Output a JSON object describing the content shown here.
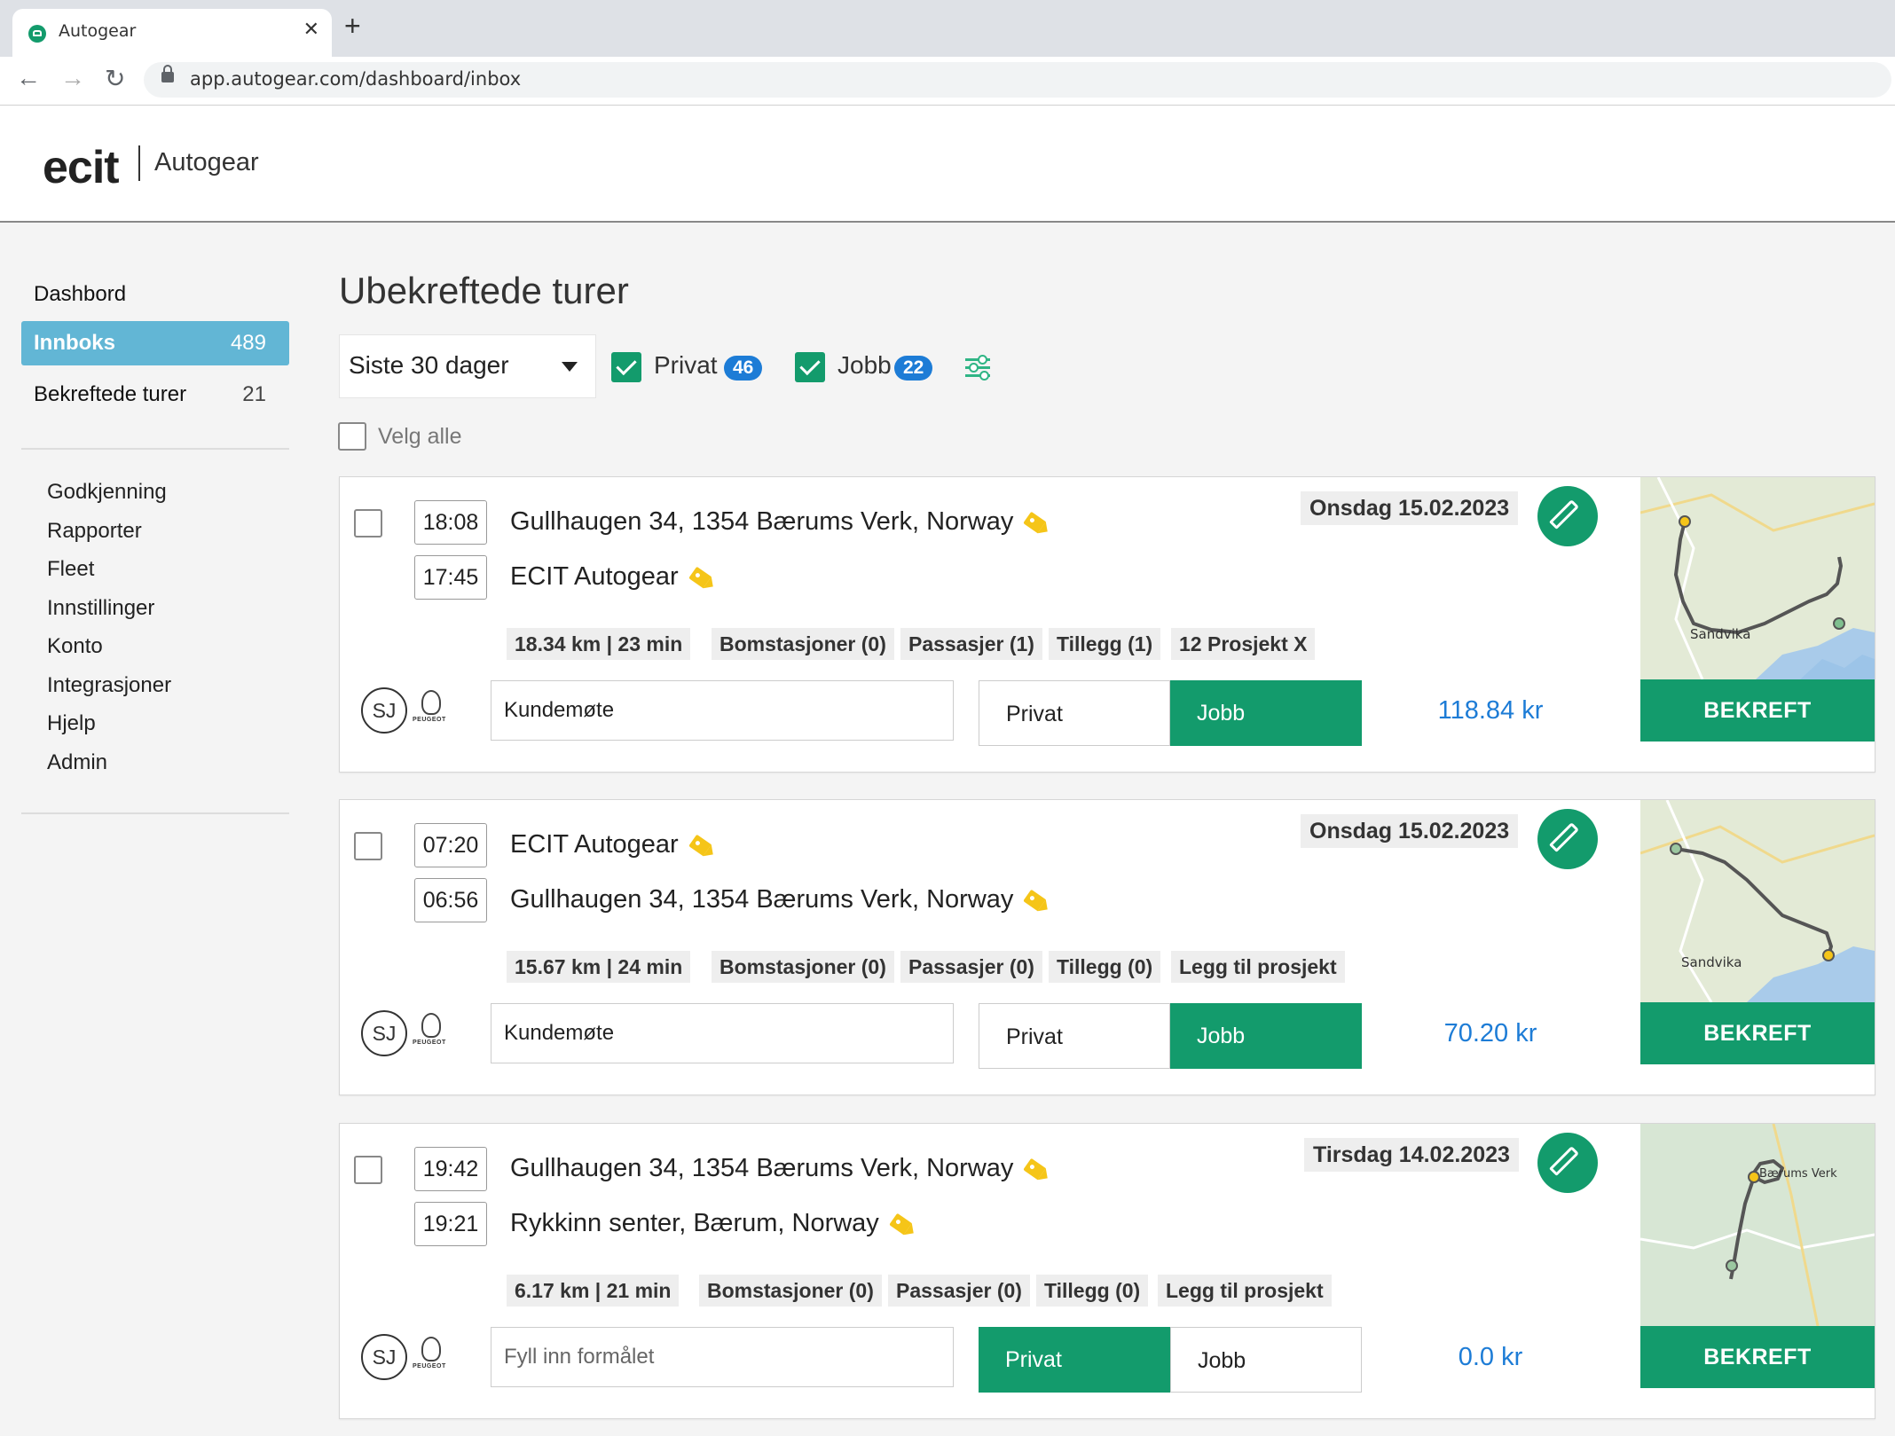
{
  "browser": {
    "tab_title": "Autogear",
    "tab_close": "✕",
    "new_tab": "+",
    "url": "app.autogear.com/dashboard/inbox"
  },
  "header": {
    "logo": "ecit",
    "product": "Autogear"
  },
  "sidebar": {
    "primary": [
      {
        "label": "Dashbord",
        "count": ""
      },
      {
        "label": "Innboks",
        "count": "489"
      },
      {
        "label": "Bekreftede turer",
        "count": "21"
      }
    ],
    "links": [
      "Godkjenning",
      "Rapporter",
      "Fleet",
      "Innstillinger",
      "Konto",
      "Integrasjoner",
      "Hjelp",
      "Admin"
    ]
  },
  "main": {
    "title": "Ubekreftede turer",
    "period": "Siste 30 dager",
    "filters": [
      {
        "label": "Privat",
        "count": "46"
      },
      {
        "label": "Jobb",
        "count": "22"
      }
    ],
    "select_all": "Velg alle"
  },
  "trips": [
    {
      "end_time": "18:08",
      "end_address": "Gullhaugen 34, 1354 Bærums Verk, Norway",
      "start_time": "17:45",
      "start_address": "ECIT Autogear",
      "date": "Onsdag 15.02.2023",
      "chips": [
        "18.34 km | 23 min",
        "Bomstasjoner (0)",
        "Passasjer (1)",
        "Tillegg (1)",
        "12 Prosjekt X"
      ],
      "driver": "SJ",
      "brand": "PEUGEOT",
      "purpose": "Kundemøte",
      "purpose_placeholder": "Fyll inn formålet",
      "private_label": "Privat",
      "business_label": "Jobb",
      "selected": "business",
      "amount": "118.84 kr",
      "confirm": "BEKREFT",
      "map_label": "Sandvika"
    },
    {
      "end_time": "07:20",
      "end_address": "ECIT Autogear",
      "start_time": "06:56",
      "start_address": "Gullhaugen 34, 1354 Bærums Verk, Norway",
      "date": "Onsdag 15.02.2023",
      "chips": [
        "15.67 km | 24 min",
        "Bomstasjoner (0)",
        "Passasjer (0)",
        "Tillegg (0)",
        "Legg til prosjekt"
      ],
      "driver": "SJ",
      "brand": "PEUGEOT",
      "purpose": "Kundemøte",
      "purpose_placeholder": "Fyll inn formålet",
      "private_label": "Privat",
      "business_label": "Jobb",
      "selected": "business",
      "amount": "70.20 kr",
      "confirm": "BEKREFT",
      "map_label": "Sandvika"
    },
    {
      "end_time": "19:42",
      "end_address": "Gullhaugen 34, 1354 Bærums Verk, Norway",
      "start_time": "19:21",
      "start_address": "Rykkinn senter, Bærum, Norway",
      "date": "Tirsdag 14.02.2023",
      "chips": [
        "6.17 km | 21 min",
        "Bomstasjoner (0)",
        "Passasjer (0)",
        "Tillegg (0)",
        "Legg til prosjekt"
      ],
      "driver": "SJ",
      "brand": "PEUGEOT",
      "purpose": "",
      "purpose_placeholder": "Fyll inn formålet",
      "private_label": "Privat",
      "business_label": "Jobb",
      "selected": "private",
      "amount": "0.0 kr",
      "confirm": "BEKREFT",
      "map_label": "Bærums Verk"
    }
  ],
  "colors": {
    "accent_green": "#139b6c",
    "sidebar_active": "#62b6d5",
    "badge_blue": "#1d7cd6",
    "tag_yellow": "#f5c518"
  }
}
